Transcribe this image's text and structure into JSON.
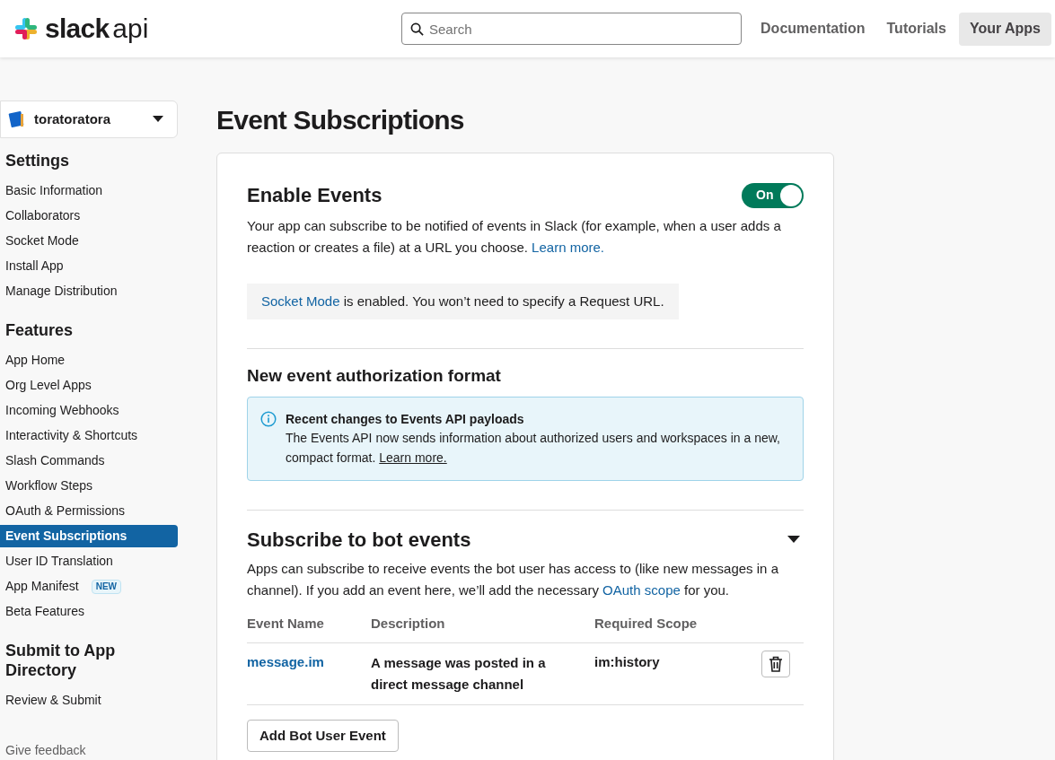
{
  "header": {
    "logo_word": "slack",
    "logo_suffix": "api",
    "search": {
      "placeholder": "Search"
    },
    "nav": [
      {
        "label": "Documentation",
        "selected": false
      },
      {
        "label": "Tutorials",
        "selected": false
      },
      {
        "label": "Your Apps",
        "selected": true
      }
    ]
  },
  "app_selector": {
    "name": "toratoratora"
  },
  "sidebar": {
    "sections": [
      {
        "title": "Settings",
        "items": [
          {
            "label": "Basic Information",
            "selected": false
          },
          {
            "label": "Collaborators",
            "selected": false
          },
          {
            "label": "Socket Mode",
            "selected": false
          },
          {
            "label": "Install App",
            "selected": false
          },
          {
            "label": "Manage Distribution",
            "selected": false
          }
        ]
      },
      {
        "title": "Features",
        "items": [
          {
            "label": "App Home",
            "selected": false
          },
          {
            "label": "Org Level Apps",
            "selected": false
          },
          {
            "label": "Incoming Webhooks",
            "selected": false
          },
          {
            "label": "Interactivity & Shortcuts",
            "selected": false
          },
          {
            "label": "Slash Commands",
            "selected": false
          },
          {
            "label": "Workflow Steps",
            "selected": false
          },
          {
            "label": "OAuth & Permissions",
            "selected": false
          },
          {
            "label": "Event Subscriptions",
            "selected": true
          },
          {
            "label": "User ID Translation",
            "selected": false
          },
          {
            "label": "App Manifest",
            "selected": false,
            "badge": "NEW"
          },
          {
            "label": "Beta Features",
            "selected": false
          }
        ]
      },
      {
        "title": "Submit to App Directory",
        "items": [
          {
            "label": "Review & Submit",
            "selected": false
          }
        ]
      }
    ],
    "feedback": "Give feedback"
  },
  "page_title": "Event Subscriptions",
  "enable_events": {
    "title": "Enable Events",
    "toggle": {
      "label": "On",
      "on": true
    },
    "description": {
      "before": "Your app can subscribe to be notified of events in Slack (for example, when a user adds a reaction or creates a file) at a URL you choose. ",
      "link": "Learn more."
    },
    "notice": {
      "link": "Socket Mode",
      "after": " is enabled. You won’t need to specify a Request URL."
    }
  },
  "authorization_format": {
    "title": "New event authorization format",
    "callout": {
      "title": "Recent changes to Events API payloads",
      "before": "The Events API now sends information about authorized users and workspaces in a new, compact format. ",
      "link": "Learn more."
    }
  },
  "bot_events": {
    "title": "Subscribe to bot events",
    "expanded": true,
    "description": {
      "before": "Apps can subscribe to receive events the bot user has access to (like new messages in a channel). If you add an event here, we’ll add the necessary ",
      "link": "OAuth scope",
      "after": " for you."
    },
    "table": {
      "columns": [
        "Event Name",
        "Description",
        "Required Scope"
      ],
      "rows": [
        {
          "event": "message.im",
          "description": "A message was posted in a direct message channel",
          "scope": "im:history"
        }
      ]
    },
    "add_button": "Add Bot User Event"
  }
}
